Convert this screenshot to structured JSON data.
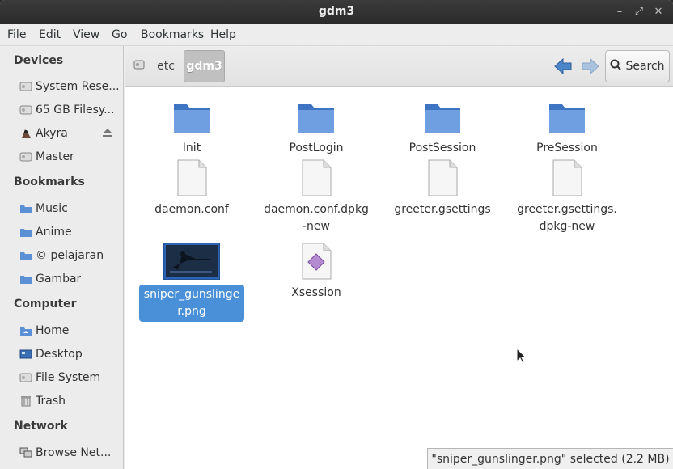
{
  "window": {
    "title": "gdm3"
  },
  "menu": [
    "File",
    "Edit",
    "View",
    "Go",
    "Bookmarks",
    "Help"
  ],
  "sidebar": {
    "devices_title": "Devices",
    "devices": [
      "System Rese...",
      "65 GB Filesy...",
      "Akyra",
      "Master"
    ],
    "bookmarks_title": "Bookmarks",
    "bookmarks": [
      "Music",
      "Anime",
      "© pelajaran",
      "Gambar"
    ],
    "computer_title": "Computer",
    "computer": [
      "Home",
      "Desktop",
      "File System",
      "Trash"
    ],
    "network_title": "Network",
    "network": [
      "Browse Net..."
    ]
  },
  "toolbar": {
    "crumbs": [
      "etc",
      "gdm3"
    ],
    "search_label": "Search"
  },
  "files": [
    {
      "name": "Init",
      "type": "folder"
    },
    {
      "name": "PostLogin",
      "type": "folder"
    },
    {
      "name": "PostSession",
      "type": "folder"
    },
    {
      "name": "PreSession",
      "type": "folder"
    },
    {
      "name": "daemon.conf",
      "type": "file"
    },
    {
      "name": "daemon.conf.dpkg-new",
      "type": "file"
    },
    {
      "name": "greeter.gsettings",
      "type": "file"
    },
    {
      "name": "greeter.gsettings.dpkg-new",
      "type": "file"
    },
    {
      "name": "sniper_gunslinger.png",
      "type": "image",
      "selected": true
    },
    {
      "name": "Xsession",
      "type": "script"
    }
  ],
  "status": "\"sniper_gunslinger.png\" selected (2.2 MB)",
  "colors": {
    "selection": "#4a90d9",
    "folder": "#5b8fd6",
    "titlebar": "#2f2f2f"
  }
}
